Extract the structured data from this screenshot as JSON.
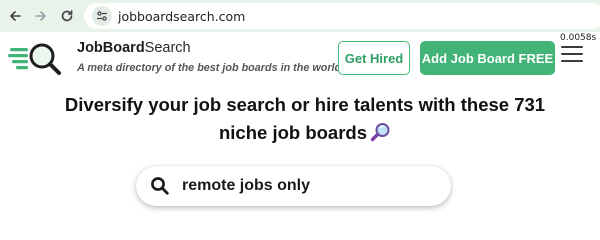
{
  "browser": {
    "url": "jobboardsearch.com",
    "icons": {
      "back": "arrow-left-icon",
      "forward": "arrow-right-icon",
      "reload": "reload-icon",
      "site_info": "tune-icon"
    }
  },
  "header": {
    "brand_bold": "JobBoard",
    "brand_light": "Search",
    "tagline": "A meta directory of the best job boards in the world.",
    "get_hired_label": "Get Hired",
    "add_board_label": "Add Job Board FREE",
    "timer": "0.0058s",
    "icons": {
      "logo": "magnifier-logo-icon",
      "menu": "hamburger-menu-icon"
    }
  },
  "hero": {
    "title_line1": "Diversify your job search or hire talents with these 731",
    "title_line2": "niche job boards",
    "title_icon": "magnifying-glass-emoji-icon"
  },
  "search": {
    "value": "remote jobs only",
    "icon": "search-icon"
  },
  "colors": {
    "brand_green": "#42b477",
    "browser_bar": "#e9f3ea",
    "text_dark": "#111111"
  }
}
